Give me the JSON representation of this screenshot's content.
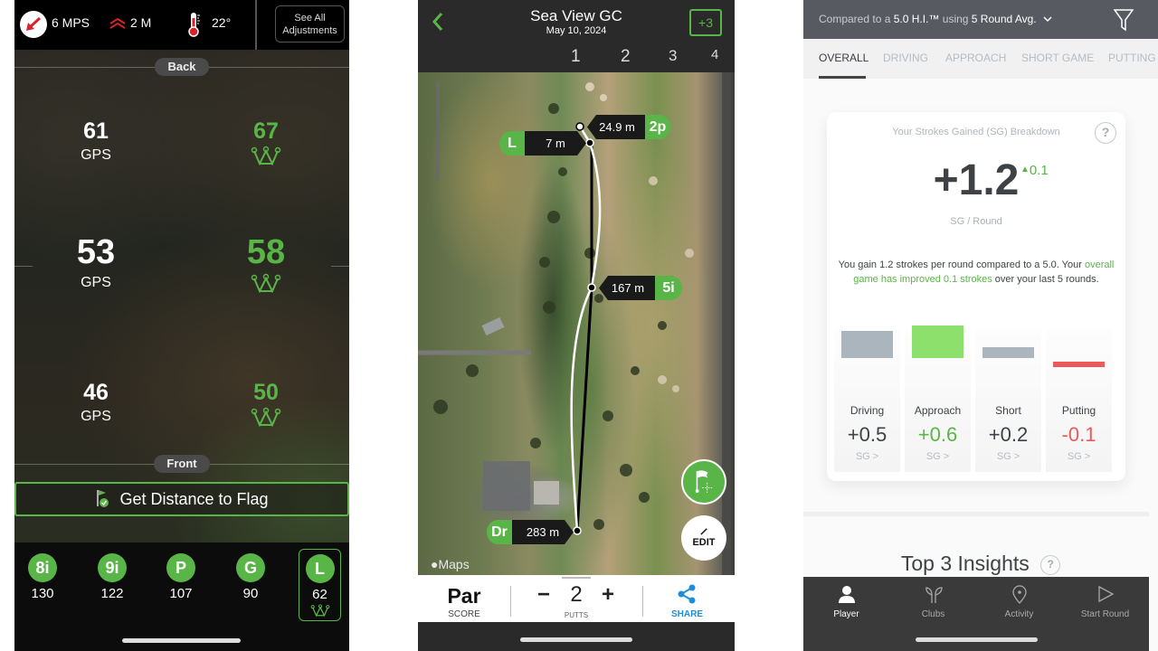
{
  "left_panel": {
    "wind": {
      "icon": "wind-arrow-icon",
      "value": "6 MPS"
    },
    "elevation": {
      "icon": "elevation-chevrons-icon",
      "value": "2 M"
    },
    "temperature": {
      "icon": "thermometer-icon",
      "value": "22°"
    },
    "adjustments_button": {
      "line1": "See All",
      "line2": "Adjustments"
    },
    "back_label": "Back",
    "front_label": "Front",
    "distances": [
      {
        "position": "back",
        "gps": "61",
        "gps_label": "GPS",
        "adjusted": "67"
      },
      {
        "position": "middle",
        "gps": "53",
        "gps_label": "GPS",
        "adjusted": "58"
      },
      {
        "position": "front",
        "gps": "46",
        "gps_label": "GPS",
        "adjusted": "50"
      }
    ],
    "flag_button_label": "Get Distance to Flag",
    "clubs": [
      {
        "club": "8i",
        "distance": "130",
        "selected": false
      },
      {
        "club": "9i",
        "distance": "122",
        "selected": false
      },
      {
        "club": "P",
        "distance": "107",
        "selected": false
      },
      {
        "club": "G",
        "distance": "90",
        "selected": false
      },
      {
        "club": "L",
        "distance": "62",
        "selected": true
      }
    ],
    "accent_color": "#5ab548"
  },
  "middle_panel": {
    "course_name": "Sea View GC",
    "date": "May 10, 2024",
    "score_badge": "+3",
    "holes": [
      "1",
      "2",
      "3",
      "4"
    ],
    "shots": [
      {
        "club": "Dr",
        "distance": "283 m"
      },
      {
        "club": "5i",
        "distance": "167 m"
      },
      {
        "club": "L",
        "distance": "7 m"
      },
      {
        "club": "2p",
        "distance": "24.9 m"
      }
    ],
    "edit_label": "EDIT",
    "maps_label": "Maps",
    "score": {
      "value": "Par",
      "label": "SCORE"
    },
    "putts": {
      "minus": "−",
      "value": "2",
      "plus": "+",
      "label": "PUTTS"
    },
    "share_label": "SHARE"
  },
  "right_panel": {
    "compare": {
      "prefix": "Compared to a",
      "handicap": "5.0 H.I.™",
      "middle": "using",
      "avg": "5 Round Avg."
    },
    "tabs": [
      {
        "label": "OVERALL",
        "active": true
      },
      {
        "label": "DRIVING",
        "active": false
      },
      {
        "label": "APPROACH",
        "active": false
      },
      {
        "label": "SHORT GAME",
        "active": false
      },
      {
        "label": "PUTTING",
        "active": false
      }
    ],
    "card": {
      "title": "Your Strokes Gained (SG) Breakdown",
      "help": "?",
      "total": "+1.2",
      "delta": "0.1",
      "unit": "SG / Round",
      "desc_part1": "You gain 1.2 strokes per round compared to a 5.0. Your ",
      "desc_highlight": "overall game has improved 0.1 strokes",
      "desc_part2": " over your last 5 rounds."
    },
    "categories": [
      {
        "name": "Driving",
        "value": "+0.5",
        "sg": 0.5,
        "link": "SG >",
        "color": "#abb5bd",
        "value_color": "#3e4247"
      },
      {
        "name": "Approach",
        "value": "+0.6",
        "sg": 0.6,
        "link": "SG >",
        "color": "#8ee06c",
        "value_color": "#5ab548"
      },
      {
        "name": "Short",
        "value": "+0.2",
        "sg": 0.2,
        "link": "SG >",
        "color": "#abb5bd",
        "value_color": "#3e4247"
      },
      {
        "name": "Putting",
        "value": "-0.1",
        "sg": -0.1,
        "link": "SG >",
        "color": "#ea5a5a",
        "value_color": "#ea5a5a"
      }
    ],
    "insights_title": "Top 3 Insights",
    "nav": [
      {
        "label": "Player",
        "icon": "person-icon",
        "active": true
      },
      {
        "label": "Clubs",
        "icon": "clubs-icon",
        "active": false
      },
      {
        "label": "Activity",
        "icon": "location-pin-icon",
        "active": false
      },
      {
        "label": "Start Round",
        "icon": "play-icon",
        "active": false
      }
    ]
  }
}
